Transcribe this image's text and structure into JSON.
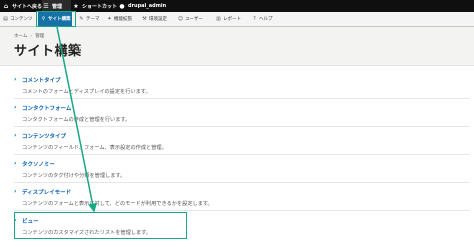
{
  "toolbar": {
    "back_label": "サイトへ戻る",
    "manage_label": "管理",
    "shortcut_label": "ショートカット",
    "user_label": "drupal_admin"
  },
  "admin_menu": {
    "items": [
      {
        "label": "コンテンツ",
        "icon": "document-icon"
      },
      {
        "label": "サイト構築",
        "icon": "structure-icon",
        "active": true
      },
      {
        "label": "テーマ",
        "icon": "paintbrush-icon"
      },
      {
        "label": "機能拡張",
        "icon": "puzzle-icon"
      },
      {
        "label": "環境設定",
        "icon": "wrench-icon"
      },
      {
        "label": "ユーザー",
        "icon": "person-icon"
      },
      {
        "label": "レポート",
        "icon": "bar-chart-icon"
      },
      {
        "label": "ヘルプ",
        "icon": "help-icon"
      }
    ]
  },
  "breadcrumb": [
    "ホーム",
    "管理"
  ],
  "page": {
    "title": "サイト構築"
  },
  "entries": [
    {
      "title": "コメントタイプ",
      "desc": "コメントのフォームとディスプレイの設定を行います。"
    },
    {
      "title": "コンタクトフォーム",
      "desc": "コンタクトフォームの作成と管理を行います。"
    },
    {
      "title": "コンテンツタイプ",
      "desc": "コンテンツのフィールド、フォーム、表示設定の作成と管理。"
    },
    {
      "title": "タクソノミー",
      "desc": "コンテンツのタグ付けや分類を管理します。"
    },
    {
      "title": "ディスプレイモード",
      "desc": "コンテンツのフォームと表示に対して、どのモードが利用できるかを設定します。"
    },
    {
      "title": "ビュー",
      "desc": "コンテンツのカスタマイズされたリストを管理します。"
    }
  ],
  "colors": {
    "accent": "#1672a6",
    "annotation": "#17a884",
    "link": "#005eb8"
  }
}
